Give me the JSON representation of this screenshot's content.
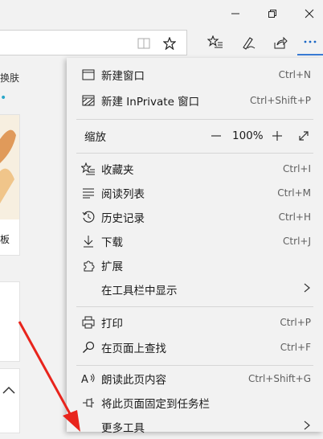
{
  "page": {
    "partial_texts": [
      "换肤",
      "板"
    ]
  },
  "menu": {
    "items_top": [
      {
        "label": "新建窗口",
        "shortcut": "Ctrl+N",
        "icon": "window-icon"
      },
      {
        "label": "新建 InPrivate 窗口",
        "shortcut": "Ctrl+Shift+P",
        "icon": "inprivate-window-icon"
      }
    ],
    "zoom": {
      "label": "缩放",
      "minus": "—",
      "value": "100%",
      "plus": "+",
      "fullscreen": "⤢"
    },
    "items_mid": [
      {
        "label": "收藏夹",
        "shortcut": "Ctrl+I",
        "icon": "favorites-star-icon"
      },
      {
        "label": "阅读列表",
        "shortcut": "Ctrl+M",
        "icon": "reading-list-icon"
      },
      {
        "label": "历史记录",
        "shortcut": "Ctrl+H",
        "icon": "history-icon"
      },
      {
        "label": "下载",
        "shortcut": "Ctrl+J",
        "icon": "download-icon"
      },
      {
        "label": "扩展",
        "shortcut": "",
        "icon": "extensions-icon"
      },
      {
        "label": "在工具栏中显示",
        "shortcut": "",
        "icon": "chevron-right-icon"
      }
    ],
    "items_bottom": [
      {
        "label": "打印",
        "shortcut": "Ctrl+P",
        "icon": "print-icon"
      },
      {
        "label": "在页面上查找",
        "shortcut": "Ctrl+F",
        "icon": "find-icon"
      },
      {
        "label": "朗读此页内容",
        "shortcut": "Ctrl+Shift+G",
        "icon": "read-aloud-icon"
      },
      {
        "label": "将此页面固定到任务栏",
        "shortcut": "",
        "icon": "pin-icon"
      },
      {
        "label": "更多工具",
        "shortcut": "",
        "icon": "chevron-right-icon"
      }
    ]
  },
  "colors": {
    "accent": "#1a67c5",
    "menu_bg": "#f2f2f2",
    "annotation_arrow": "#e8241c"
  }
}
